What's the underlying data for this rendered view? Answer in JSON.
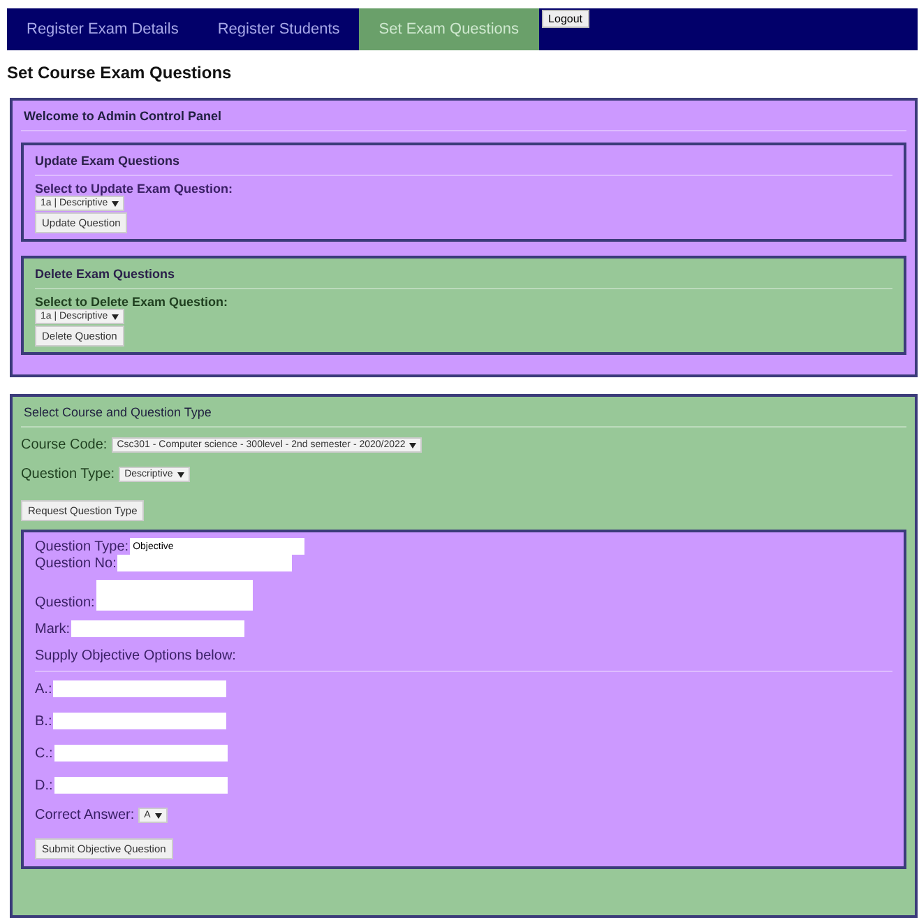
{
  "nav": {
    "tabs": [
      {
        "label": "Register Exam Details",
        "selected": false
      },
      {
        "label": "Register Students",
        "selected": false
      },
      {
        "label": "Set Exam Questions",
        "selected": true
      }
    ],
    "logout": "Logout"
  },
  "heading": "Set Course Exam Questions",
  "admin_panel": {
    "title": "Welcome to Admin Control Panel",
    "sections": [
      {
        "kind": "update",
        "title": "Update Exam Questions",
        "label": "Select to Update Exam Question:",
        "select": "1a | Descriptive",
        "button": "Update Question"
      },
      {
        "kind": "delete",
        "title": "Delete Exam Questions",
        "label": "Select to Delete Exam Question:",
        "select": "1a | Descriptive",
        "button": "Delete Question"
      }
    ]
  },
  "course_panel": {
    "title": "Select Course and Question Type",
    "course_code": {
      "label": "Course Code:",
      "value": "Csc301 - Computer science - 300level - 2nd semester - 2020/2022"
    },
    "question_type": {
      "label": "Question Type:",
      "value": "Descriptive"
    },
    "button": "Request Question Type",
    "form": {
      "question_type": {
        "label": "Question Type:",
        "value": "Objective"
      },
      "question_no": {
        "label": "Question No:"
      },
      "question": {
        "label": "Question:"
      },
      "mark": {
        "label": "Mark:"
      },
      "options_title": "Supply Objective Options below:",
      "options": [
        {
          "label": "A.:"
        },
        {
          "label": "B.:"
        },
        {
          "label": "C.:"
        },
        {
          "label": "D.:"
        }
      ],
      "correct_answer": {
        "label": "Correct Answer:",
        "value": "A"
      },
      "button": "Submit Objective Question"
    }
  }
}
